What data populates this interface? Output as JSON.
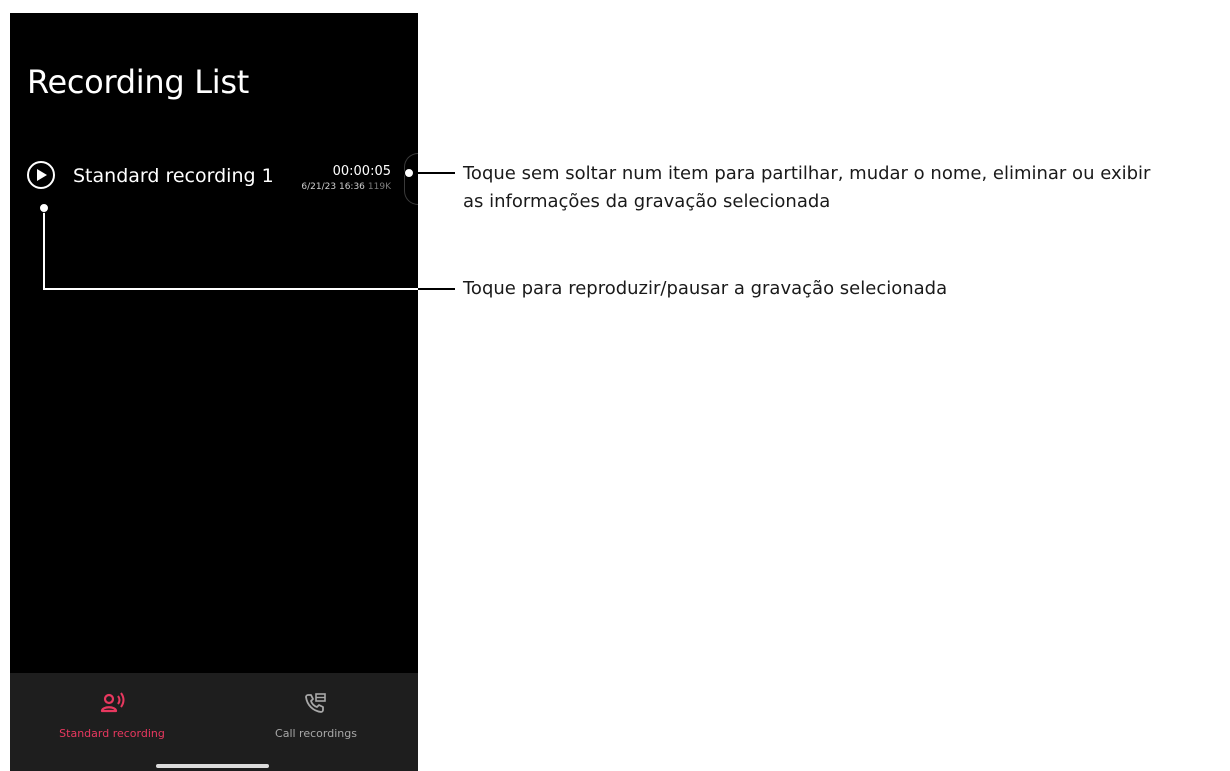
{
  "screen": {
    "title": "Recording List"
  },
  "recording": {
    "name": "Standard recording 1",
    "duration": "00:00:05",
    "date": "6/21/23 16:36",
    "size": "119K"
  },
  "navbar": {
    "items": [
      {
        "label": "Standard recording",
        "icon": "person-voice-icon",
        "active": true
      },
      {
        "label": "Call recordings",
        "icon": "phone-recording-icon",
        "active": false
      }
    ]
  },
  "callouts": {
    "long_press": {
      "line1": "Toque sem soltar num item para partilhar, mudar o nome, eliminar ou exibir",
      "line2": "as informações da gravação selecionada"
    },
    "play": "Toque para reproduzir/pausar a gravação selecionada"
  },
  "colors": {
    "active_tab": "#e8385f",
    "inactive_tab": "#a8a8a8",
    "phone_bg": "#000000",
    "navbar_bg": "#1e1e1e"
  }
}
